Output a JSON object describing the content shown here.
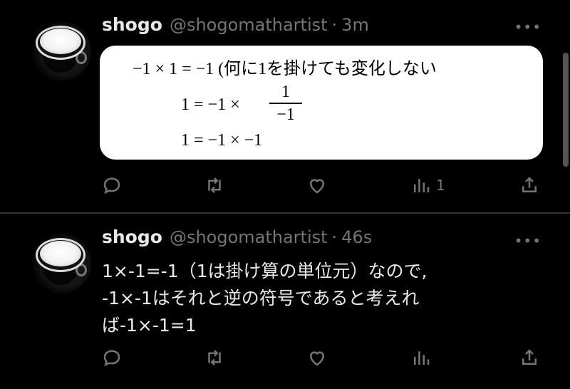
{
  "tweets": [
    {
      "display_name": "shogo",
      "handle": "@shogomathartist",
      "separator": "·",
      "time": "3m",
      "more": "•••",
      "math": {
        "line1": "−1 × 1 = −1  (何に1を掛けても変化しない",
        "line2_left": "1 = −1 ×",
        "frac_num": "1",
        "frac_den": "−1",
        "line3": "1 = −1 × −1"
      },
      "views_count": "1"
    },
    {
      "display_name": "shogo",
      "handle": "@shogomathartist",
      "separator": "·",
      "time": "46s",
      "more": "•••",
      "text_lines": [
        "1×-1=-1（1は掛け算の単位元）なので,",
        "-1×-1はそれと逆の符号であると考えれ",
        "ば-1×-1=1"
      ]
    }
  ]
}
